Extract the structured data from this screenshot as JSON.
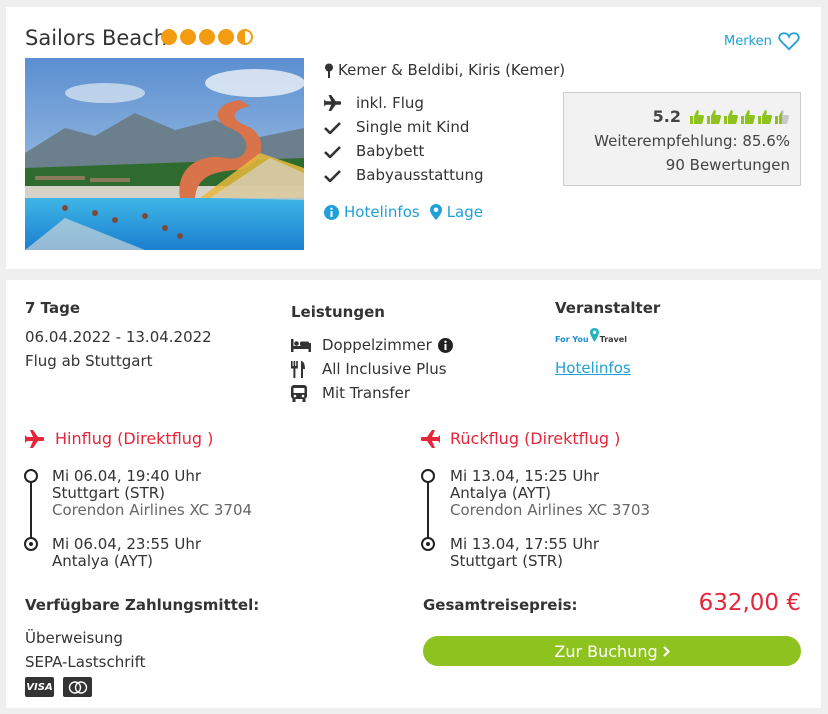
{
  "hotel": {
    "name": "Sailors Beach",
    "star_rating": 4.5,
    "location": "Kemer & Beldibi, Kiris (Kemer)",
    "features": [
      "inkl. Flug",
      "Single mit Kind",
      "Babybett",
      "Babyausstattung"
    ],
    "links": {
      "hotelinfo": "Hotelinfos",
      "lage": "Lage"
    },
    "merken": "Merken",
    "rating": {
      "score": "5.2",
      "thumbs_of_6": 5.5,
      "recommendation": "Weiterempfehlung: 85.6%",
      "reviews": "90 Bewertungen"
    }
  },
  "offer": {
    "duration": "7 Tage",
    "dates": "06.04.2022 - 13.04.2022",
    "departure": "Flug ab Stuttgart",
    "services_title": "Leistungen",
    "services": [
      "Doppelzimmer",
      "All Inclusive Plus",
      "Mit Transfer"
    ],
    "operator_title": "Veranstalter",
    "operator_logo": {
      "part1": "For You",
      "part2": "Travel"
    },
    "operator_link": "Hotelinfos"
  },
  "outbound": {
    "title": "Hinflug (Direktflug )",
    "dep_time": "Mi 06.04, 19:40 Uhr",
    "dep_airport": "Stuttgart (STR)",
    "airline": "Corendon Airlines XC 3704",
    "arr_time": "Mi 06.04, 23:55 Uhr",
    "arr_airport": "Antalya (AYT)"
  },
  "inbound": {
    "title": "Rückflug (Direktflug )",
    "dep_time": "Mi 13.04, 15:25 Uhr",
    "dep_airport": "Antalya (AYT)",
    "airline": "Corendon Airlines XC 3703",
    "arr_time": "Mi 13.04, 17:55 Uhr",
    "arr_airport": "Stuttgart (STR)"
  },
  "payment": {
    "title": "Verfügbare Zahlungsmittel:",
    "methods": [
      "Überweisung",
      "SEPA-Lastschrift"
    ],
    "card_icons": {
      "visa": "VISA"
    }
  },
  "total": {
    "label": "Gesamtreisepreis:",
    "price": "632,00 €",
    "button": "Zur Buchung"
  },
  "colors": {
    "accent": "#1fa0d8",
    "flight_red": "#e5263a",
    "star": "#f39c12",
    "book_green": "#8ec31f",
    "thumb_green": "#8dc21f"
  }
}
